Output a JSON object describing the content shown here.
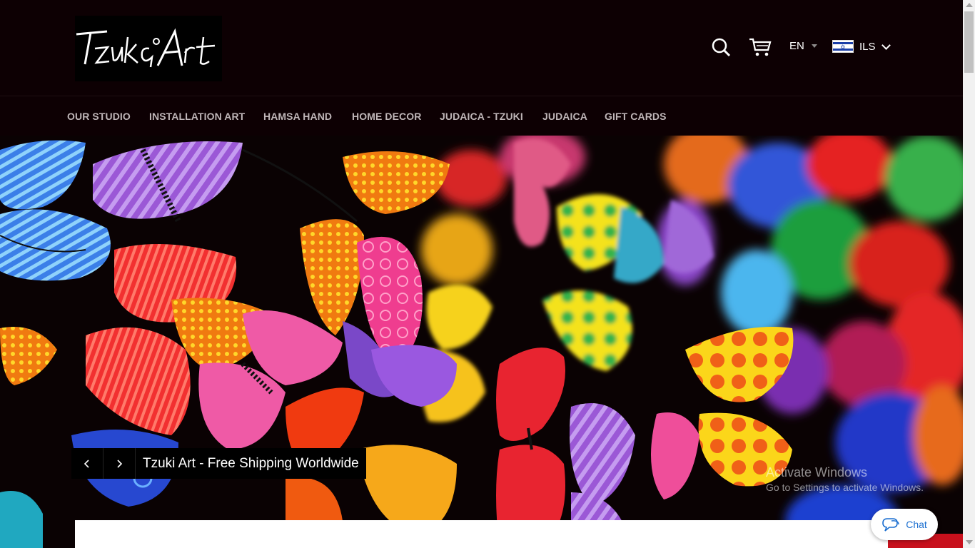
{
  "header": {
    "logo_text": "TzukiArt",
    "language": "EN",
    "currency": "ILS"
  },
  "nav": {
    "items": [
      {
        "label": "OUR STUDIO"
      },
      {
        "label": "INSTALLATION ART"
      },
      {
        "label": "HAMSA HAND"
      },
      {
        "label": "HOME DECOR"
      },
      {
        "label": "JUDAICA - TZUKI"
      },
      {
        "label": "JUDAICA"
      },
      {
        "label": "GIFT CARDS"
      }
    ]
  },
  "hero": {
    "caption": "Tzuki Art - Free Shipping Worldwide",
    "prev_icon": "chevron-left-icon",
    "next_icon": "chevron-right-icon"
  },
  "watermark": {
    "title": "Activate Windows",
    "subtitle": "Go to Settings to activate Windows."
  },
  "chat": {
    "label": "Chat",
    "icon": "chat-bubble-icon"
  },
  "colors": {
    "header_bg": "#0d0003",
    "nav_text": "#bfb6b8",
    "chat_accent": "#1c6fd0",
    "strip_red": "#c8101c"
  }
}
